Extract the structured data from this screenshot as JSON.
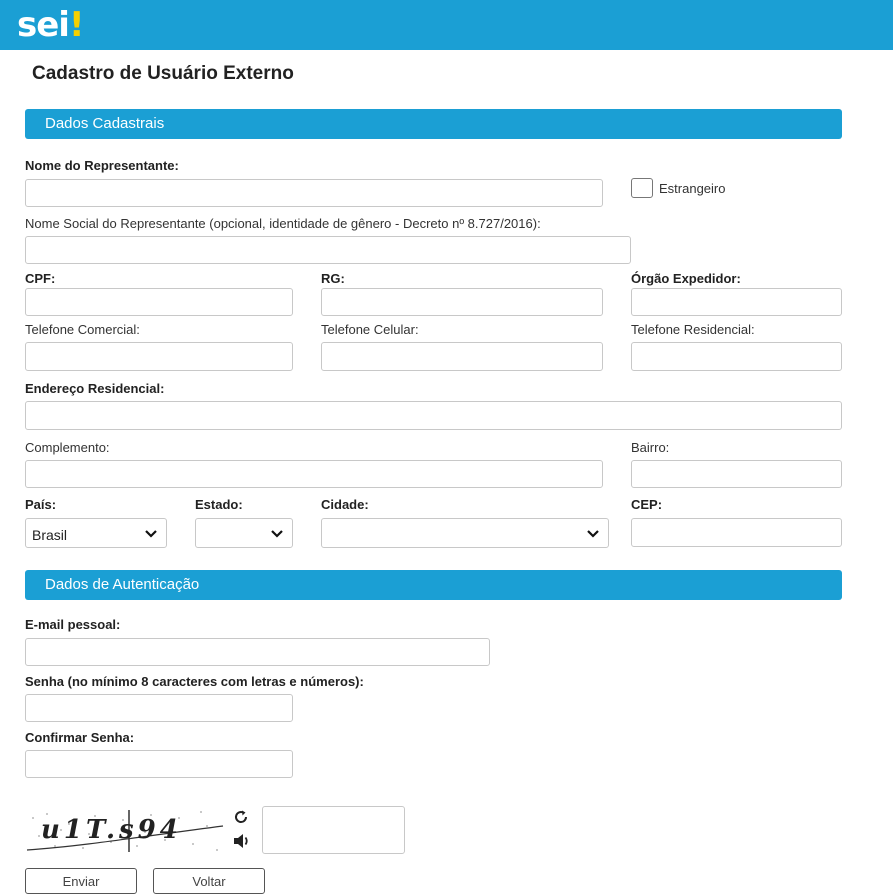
{
  "app": {
    "logo_text": "sei",
    "logo_accent": "!"
  },
  "page": {
    "title": "Cadastro de Usuário Externo"
  },
  "colors": {
    "brand": "#1b9fd4",
    "accent": "#f5d000"
  },
  "sections": {
    "personal": "Dados Cadastrais",
    "auth": "Dados de Autenticação"
  },
  "fields": {
    "nome_representante": "Nome do Representante:",
    "estrangeiro": "Estrangeiro",
    "nome_social": "Nome Social do Representante (opcional, identidade de gênero - Decreto nº 8.727/2016):",
    "cpf": "CPF:",
    "rg": "RG:",
    "orgao_expedidor": "Órgão Expedidor:",
    "telefone_comercial": "Telefone Comercial:",
    "telefone_celular": "Telefone Celular:",
    "telefone_residencial": "Telefone Residencial:",
    "endereco": "Endereço Residencial:",
    "complemento": "Complemento:",
    "bairro": "Bairro:",
    "pais": "País:",
    "estado": "Estado:",
    "cidade": "Cidade:",
    "cep": "CEP:",
    "email": "E-mail pessoal:",
    "senha": "Senha (no mínimo 8 caracteres com letras e números):",
    "confirmar_senha": "Confirmar Senha:"
  },
  "values": {
    "pais": "Brasil",
    "estado": "",
    "cidade": ""
  },
  "captcha": {
    "text": "u1T.s94",
    "refresh_icon": "refresh-icon",
    "audio_icon": "speaker-icon"
  },
  "buttons": {
    "enviar": "Enviar",
    "voltar": "Voltar"
  }
}
